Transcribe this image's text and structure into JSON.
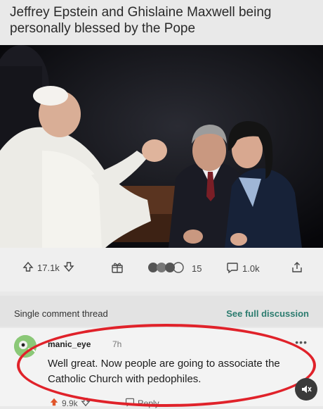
{
  "post": {
    "title": "Jeffrey Epstein and Ghislaine Maxwell being personally blessed by the Pope"
  },
  "actions": {
    "upvotes": "17.1k",
    "awards": "15",
    "comments": "1.0k"
  },
  "thread": {
    "label": "Single comment thread",
    "see_full": "See full discussion"
  },
  "comment": {
    "username": "manic_eye",
    "age": "7h",
    "text": "Well great. Now people are going to associate the Catholic Church with pedophiles.",
    "score": "9.9k",
    "reply_label": "Reply"
  },
  "colors": {
    "highlight_circle": "#e0222a",
    "link_green": "#2c7c6f"
  },
  "icons": [
    "upvote-icon",
    "downvote-icon",
    "award-icon",
    "comment-icon",
    "share-icon",
    "more-icon",
    "mute-icon",
    "avatar"
  ]
}
